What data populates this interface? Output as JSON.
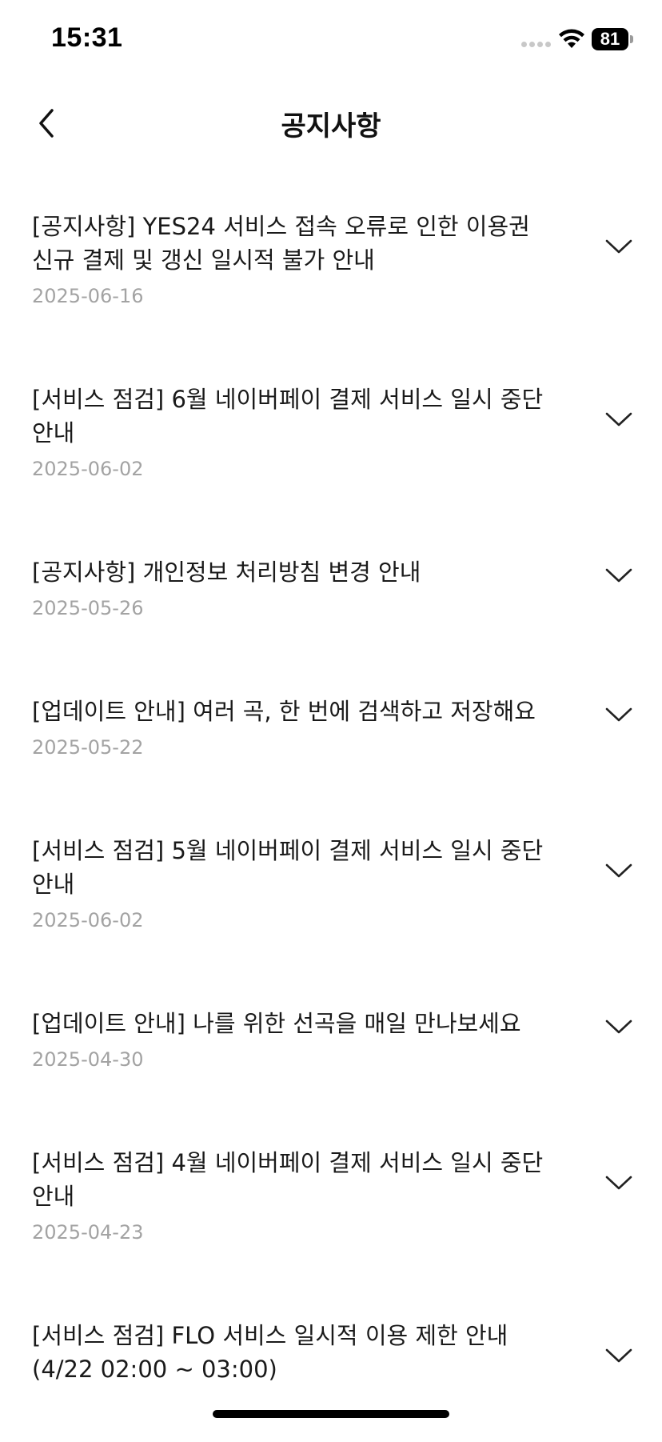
{
  "status_bar": {
    "time": "15:31",
    "battery": "81"
  },
  "header": {
    "title": "공지사항",
    "back_icon": "chevron-left-icon"
  },
  "notices": [
    {
      "title": "[공지사항] YES24 서비스 접속 오류로 인한 이용권 신규 결제 및 갱신 일시적 불가 안내",
      "date": "2025-06-16"
    },
    {
      "title": "[서비스 점검] 6월 네이버페이 결제 서비스 일시 중단 안내",
      "date": "2025-06-02"
    },
    {
      "title": "[공지사항] 개인정보 처리방침 변경 안내",
      "date": "2025-05-26"
    },
    {
      "title": "[업데이트 안내] 여러 곡, 한 번에 검색하고 저장해요",
      "date": "2025-05-22"
    },
    {
      "title": "[서비스 점검] 5월 네이버페이 결제 서비스 일시 중단 안내",
      "date": "2025-06-02"
    },
    {
      "title": "[업데이트 안내] 나를 위한 선곡을 매일 만나보세요",
      "date": "2025-04-30"
    },
    {
      "title": "[서비스 점검] 4월 네이버페이 결제 서비스 일시 중단 안내",
      "date": "2025-04-23"
    },
    {
      "title": "[서비스 점검] FLO 서비스 일시적 이용 제한 안내 (4/22 02:00 ~ 03:00)",
      "date": ""
    }
  ],
  "icons": {
    "expand": "chevron-down-icon"
  }
}
